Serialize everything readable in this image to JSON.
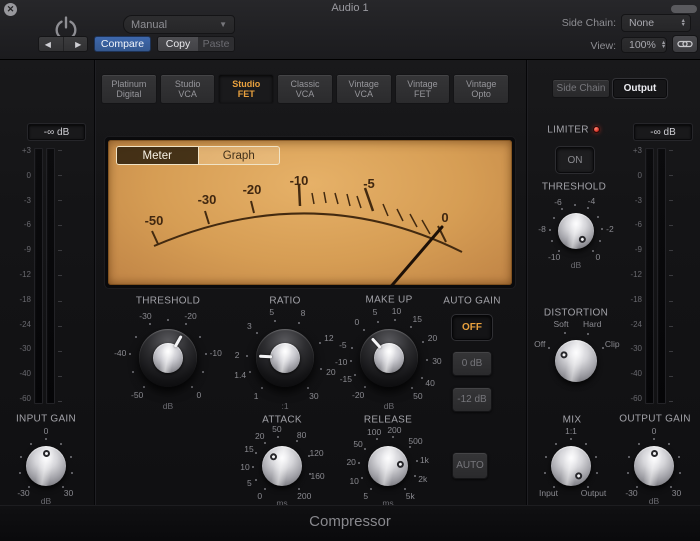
{
  "colors": {
    "accent": "#e9a13e",
    "compare_blue": "#3e68ac",
    "led_red": "#d8382c",
    "vu_amber": "#d69d54"
  },
  "window": {
    "title": "Audio 1",
    "close": "✕"
  },
  "header": {
    "preset_value": "Manual",
    "prev": "◀",
    "next": "▶",
    "compare": "Compare",
    "copy": "Copy",
    "paste": "Paste",
    "side_chain_label": "Side Chain:",
    "side_chain_value": "None",
    "view_label": "View:",
    "view_value": "100%"
  },
  "models": [
    {
      "line1": "Platinum",
      "line2": "Digital",
      "selected": false
    },
    {
      "line1": "Studio",
      "line2": "VCA",
      "selected": false
    },
    {
      "line1": "Studio",
      "line2": "FET",
      "selected": true
    },
    {
      "line1": "Classic",
      "line2": "VCA",
      "selected": false
    },
    {
      "line1": "Vintage",
      "line2": "VCA",
      "selected": false
    },
    {
      "line1": "Vintage",
      "line2": "FET",
      "selected": false
    },
    {
      "line1": "Vintage",
      "line2": "Opto",
      "selected": false
    }
  ],
  "routing": {
    "side_chain": "Side Chain",
    "output": "Output"
  },
  "display": {
    "meter_tab": "Meter",
    "graph_tab": "Graph",
    "scale": [
      "-50",
      "-30",
      "-20",
      "-10",
      "-5",
      "0"
    ]
  },
  "meter_scale": [
    "+3",
    "0",
    "-3",
    "-6",
    "-9",
    "-12",
    "-18",
    "-24",
    "-30",
    "-40",
    "-60"
  ],
  "meters": {
    "left_readout": "-∞ dB",
    "right_readout": "-∞ dB"
  },
  "auto_gain": {
    "label": "AUTO GAIN",
    "options": [
      "OFF",
      "0 dB",
      "-12 dB"
    ],
    "selected": "OFF"
  },
  "limiter": {
    "label": "LIMITER",
    "on": "ON"
  },
  "release_auto": "AUTO",
  "knobs": {
    "threshold": {
      "label": "THRESHOLD",
      "unit": "dB",
      "pointer": 30,
      "ticks": [
        {
          "t": "-50",
          "a": -140
        },
        {
          "t": "-40",
          "a": -84
        },
        {
          "t": "-30",
          "a": -28
        },
        {
          "t": "-20",
          "a": 28
        },
        {
          "t": "-10",
          "a": 84
        },
        {
          "t": "0",
          "a": 140
        }
      ]
    },
    "ratio": {
      "label": "RATIO",
      "unit": ":1",
      "pointer": -87,
      "ticks": [
        {
          "t": "1",
          "a": -143
        },
        {
          "t": "1.4",
          "a": -111
        },
        {
          "t": "2",
          "a": -87
        },
        {
          "t": "3",
          "a": -48
        },
        {
          "t": "5",
          "a": -16
        },
        {
          "t": "8",
          "a": 22
        },
        {
          "t": "12",
          "a": 66
        },
        {
          "t": "20",
          "a": 107
        },
        {
          "t": "30",
          "a": 143
        }
      ]
    },
    "makeup": {
      "label": "MAKE UP",
      "unit": "dB",
      "pointer": -42,
      "ticks": [
        {
          "t": "-20",
          "a": -140
        },
        {
          "t": "-15",
          "a": -116
        },
        {
          "t": "-10",
          "a": -95
        },
        {
          "t": "-5",
          "a": -74
        },
        {
          "t": "0",
          "a": -42
        },
        {
          "t": "5",
          "a": -17
        },
        {
          "t": "10",
          "a": 9
        },
        {
          "t": "15",
          "a": 36
        },
        {
          "t": "20",
          "a": 65
        },
        {
          "t": "30",
          "a": 93
        },
        {
          "t": "40",
          "a": 121
        },
        {
          "t": "50",
          "a": 143
        }
      ]
    },
    "attack": {
      "label": "ATTACK",
      "unit": "ms",
      "pointer": -45,
      "ticks": [
        {
          "t": "0",
          "a": -143
        },
        {
          "t": "5",
          "a": -118
        },
        {
          "t": "10",
          "a": -92
        },
        {
          "t": "15",
          "a": -63
        },
        {
          "t": "20",
          "a": -37
        },
        {
          "t": "50",
          "a": -8
        },
        {
          "t": "80",
          "a": 32
        },
        {
          "t": "120",
          "a": 69
        },
        {
          "t": "160",
          "a": 106
        },
        {
          "t": "200",
          "a": 143
        }
      ]
    },
    "release": {
      "label": "RELEASE",
      "unit": "ms",
      "pointer": 80,
      "ticks": [
        {
          "t": "5",
          "a": -143
        },
        {
          "t": "10",
          "a": -114
        },
        {
          "t": "20",
          "a": -84
        },
        {
          "t": "50",
          "a": -54
        },
        {
          "t": "100",
          "a": -22
        },
        {
          "t": "200",
          "a": 10
        },
        {
          "t": "500",
          "a": 48
        },
        {
          "t": "1k",
          "a": 80
        },
        {
          "t": "2k",
          "a": 110
        },
        {
          "t": "5k",
          "a": 143
        }
      ]
    },
    "input_gain": {
      "label": "INPUT GAIN",
      "unit": "dB",
      "pointer": 0,
      "ticks": [
        {
          "t": "-30",
          "a": -140
        },
        {
          "t": "0",
          "a": 0
        },
        {
          "t": "30",
          "a": 140
        }
      ]
    },
    "limiter_threshold": {
      "label": "THRESHOLD",
      "unit": "dB",
      "pointer": 140,
      "ticks": [
        {
          "t": "-10",
          "a": -140
        },
        {
          "t": "-8",
          "a": -87
        },
        {
          "t": "-6",
          "a": -32
        },
        {
          "t": "-4",
          "a": 27
        },
        {
          "t": "-2",
          "a": 86
        },
        {
          "t": "0",
          "a": 140
        }
      ]
    },
    "distortion": {
      "label": "DISTORTION",
      "pointer": -65,
      "ticks": [
        {
          "t": "Off",
          "a": -65
        },
        {
          "t": "Soft",
          "a": -22
        },
        {
          "t": "Hard",
          "a": 24
        },
        {
          "t": "Clip",
          "a": 65
        }
      ]
    },
    "mix": {
      "label": "MIX",
      "pointer": 140,
      "ticks": [
        {
          "t": "Input",
          "a": -140
        },
        {
          "t": "1:1",
          "a": 0
        },
        {
          "t": "Output",
          "a": 140
        }
      ]
    },
    "output_gain": {
      "label": "OUTPUT GAIN",
      "unit": "dB",
      "pointer": 0,
      "ticks": [
        {
          "t": "-30",
          "a": -140
        },
        {
          "t": "0",
          "a": 0
        },
        {
          "t": "30",
          "a": 140
        }
      ]
    }
  },
  "footer": {
    "plugin_name": "Compressor"
  }
}
